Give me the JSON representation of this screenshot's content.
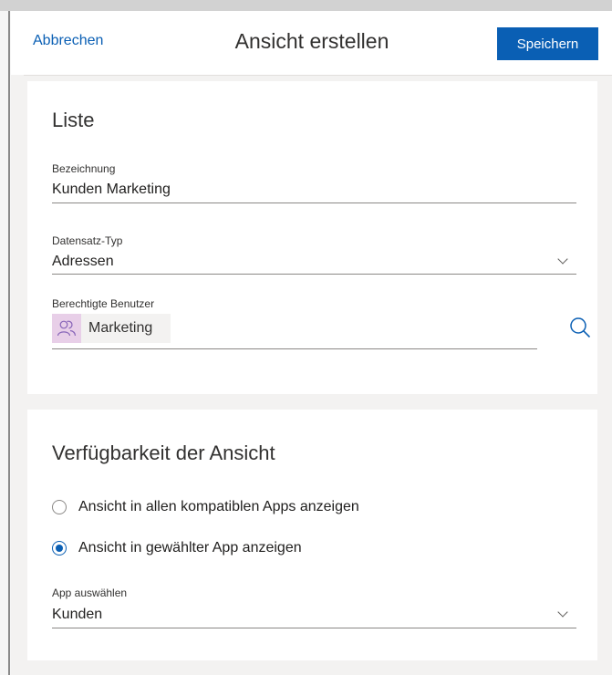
{
  "header": {
    "cancel_label": "Abbrechen",
    "title": "Ansicht erstellen",
    "save_label": "Speichern"
  },
  "list_section": {
    "title": "Liste",
    "name_field": {
      "label": "Bezeichnung",
      "value": "Kunden Marketing"
    },
    "record_type_field": {
      "label": "Datensatz-Typ",
      "value": "Adressen"
    },
    "authorized_users_field": {
      "label": "Berechtigte Benutzer",
      "users": [
        {
          "name": "Marketing",
          "icon": "group-icon"
        }
      ]
    }
  },
  "availability_section": {
    "title": "Verfügbarkeit der Ansicht",
    "options": [
      {
        "label": "Ansicht in allen kompatiblen Apps anzeigen",
        "selected": false
      },
      {
        "label": "Ansicht in gewählter App anzeigen",
        "selected": true
      }
    ],
    "app_field": {
      "label": "App auswählen",
      "value": "Kunden"
    }
  },
  "colors": {
    "accent": "#0a5fb4",
    "panel_background": "#f3f2f1",
    "chip_icon_background": "#e8cfe8"
  }
}
